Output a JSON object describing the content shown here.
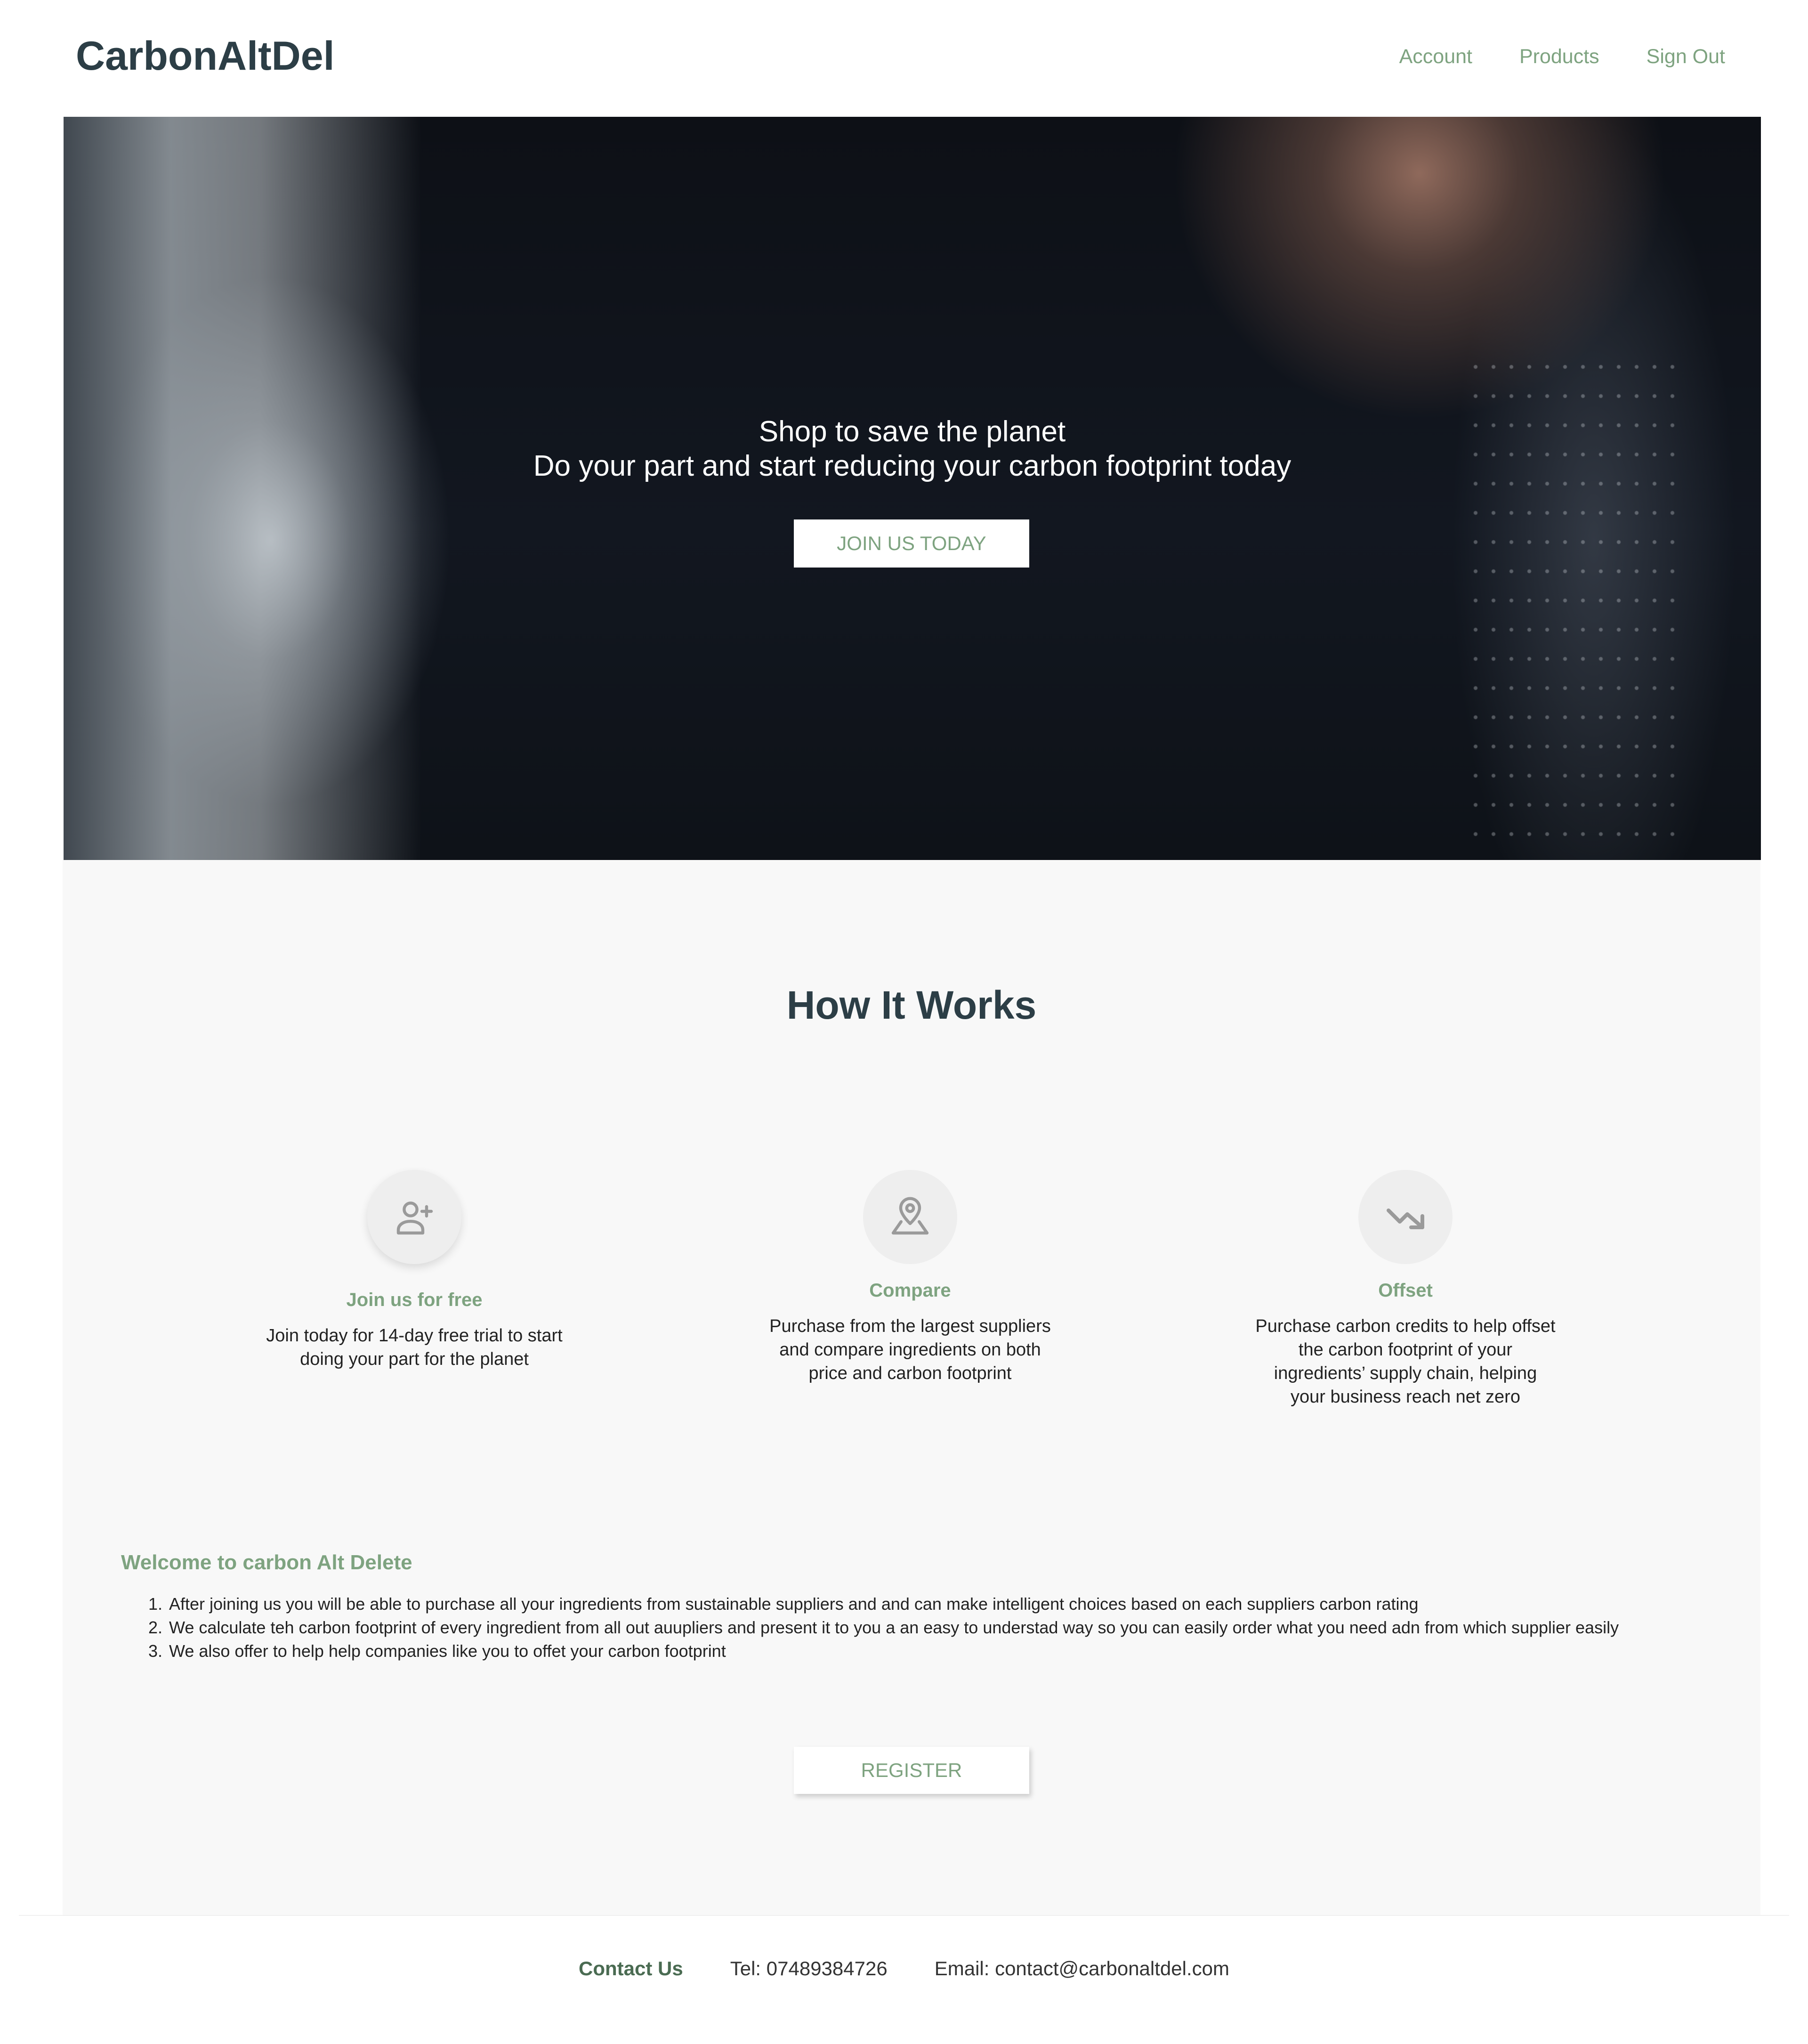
{
  "header": {
    "logo": "CarbonAltDel",
    "nav": [
      "Account",
      "Products",
      "Sign Out"
    ]
  },
  "hero": {
    "title": "Shop to save the planet",
    "subtitle": "Do your part and start reducing your carbon footprint today",
    "cta_label": "JOIN US TODAY"
  },
  "how": {
    "title": "How It Works",
    "steps": [
      {
        "icon": "user-plus-icon",
        "title": "Join us for free",
        "description": "Join today for 14-day free trial to start doing your part for the planet"
      },
      {
        "icon": "map-pin-icon",
        "title": "Compare",
        "description": "Purchase from the largest suppliers and compare ingredients on both price and carbon footprint"
      },
      {
        "icon": "trending-down-icon",
        "title": "Offset",
        "description": "Purchase carbon credits to help offset the carbon footprint of your ingredients’ supply chain, helping your business reach net zero"
      }
    ]
  },
  "welcome": {
    "title": "Welcome to carbon Alt Delete",
    "items": [
      "After joining us you will be able to purchase all your ingredients from sustainable suppliers and and can make intelligent choices based on each suppliers carbon rating",
      "We calculate teh carbon footprint of every ingredient from all out auupliers and present it to you a an easy to understad way so you can easily order what you need adn from which supplier easily",
      "We also offer to help help companies like you to offet your carbon footprint"
    ],
    "register_label": "REGISTER"
  },
  "footer": {
    "contact_label": "Contact Us",
    "tel": "Tel: 07489384726",
    "email": "Email: contact@carbonaltdel.com"
  },
  "colors": {
    "accent": "#7ea380",
    "heading": "#2c3e46",
    "section_bg": "#f8f8f8"
  }
}
